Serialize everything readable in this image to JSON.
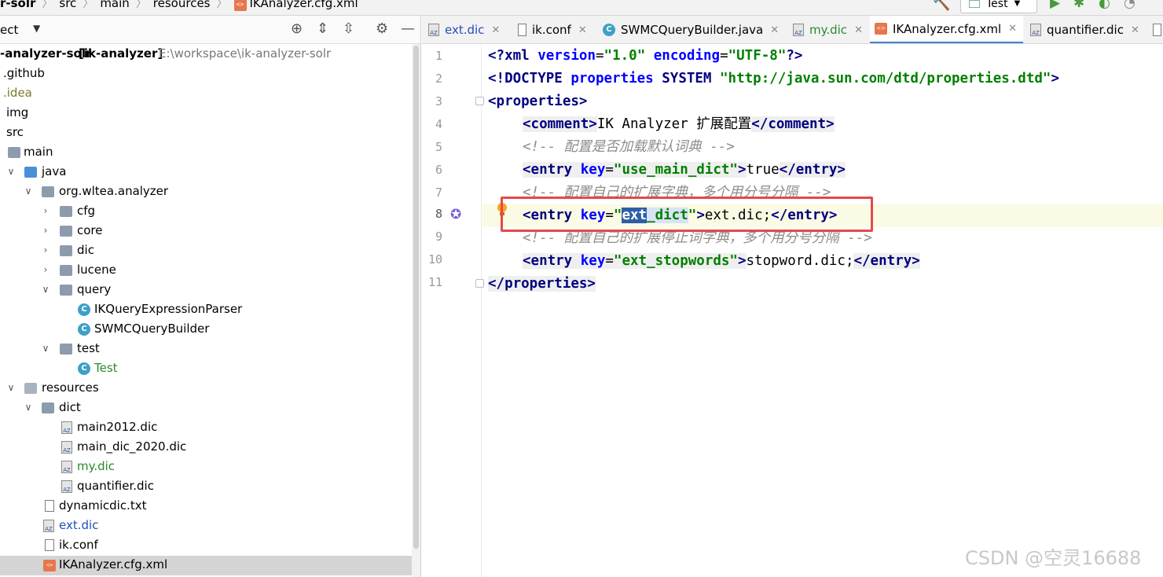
{
  "navbar": {
    "crumbs": [
      "r-solr",
      "src",
      "main",
      "resources",
      "IKAnalyzer.cfg.xml"
    ],
    "run_config": "Test"
  },
  "project": {
    "title": "ect",
    "root": {
      "name": "-analyzer-solr",
      "module": "[ik-analyzer]",
      "path": "E:\\workspace\\ik-analyzer-solr"
    },
    "tree": [
      {
        "label": ".github"
      },
      {
        "label": ".idea"
      },
      {
        "label": "img"
      },
      {
        "label": "src"
      },
      {
        "label": "main"
      },
      {
        "label": "java"
      },
      {
        "label": "org.wltea.analyzer"
      },
      {
        "label": "cfg"
      },
      {
        "label": "core"
      },
      {
        "label": "dic"
      },
      {
        "label": "lucene"
      },
      {
        "label": "query"
      },
      {
        "label": "IKQueryExpressionParser"
      },
      {
        "label": "SWMCQueryBuilder"
      },
      {
        "label": "test"
      },
      {
        "label": "Test"
      },
      {
        "label": "resources"
      },
      {
        "label": "dict"
      },
      {
        "label": "main2012.dic"
      },
      {
        "label": "main_dic_2020.dic"
      },
      {
        "label": "my.dic"
      },
      {
        "label": "quantifier.dic"
      },
      {
        "label": "dynamicdic.txt"
      },
      {
        "label": "ext.dic"
      },
      {
        "label": "ik.conf"
      },
      {
        "label": "IKAnalyzer.cfg.xml"
      }
    ]
  },
  "editor": {
    "tabs": [
      {
        "label": "ext.dic"
      },
      {
        "label": "ik.conf"
      },
      {
        "label": "SWMCQueryBuilder.java"
      },
      {
        "label": "my.dic"
      },
      {
        "label": "IKAnalyzer.cfg.xml"
      },
      {
        "label": "quantifier.dic"
      }
    ],
    "line_numbers": [
      "1",
      "2",
      "3",
      "4",
      "5",
      "6",
      "7",
      "8",
      "9",
      "10",
      "11"
    ],
    "code": {
      "l1": {
        "a": "<?",
        "b": "xml ",
        "c": "version",
        "d": "=",
        "e": "\"1.0\"",
        "f": " encoding",
        "g": "=",
        "h": "\"UTF-8\"",
        "i": "?>"
      },
      "l2": {
        "a": "<!DOCTYPE ",
        "b": "properties",
        "c": " SYSTEM ",
        "d": "\"http://java.sun.com/dtd/properties.dtd\"",
        "e": ">"
      },
      "l3": {
        "a": "<properties>"
      },
      "l4": {
        "a": "<comment>",
        "b": "IK Analyzer 扩展配置",
        "c": "</comment>"
      },
      "l5": {
        "a": "<!-- 配置是否加载默认词典 -->"
      },
      "l6": {
        "a": "<entry ",
        "b": "key",
        "c": "=",
        "d": "\"use_main_dict\"",
        "e": ">",
        "f": "true",
        "g": "</entry>"
      },
      "l7": {
        "a": "<!-- 配置自己的扩展字典，多个用分号分隔 -->"
      },
      "l8": {
        "a": "<entry ",
        "b": "key",
        "c": "=",
        "d": "\"",
        "e": "ext",
        "f": "_dict",
        "g": "\"",
        "h": ">",
        "i": "ext.dic;",
        "j": "</entry>"
      },
      "l9": {
        "a": "<!-- 配置自己的扩展停止词字典，多个用分号分隔 -->"
      },
      "l10": {
        "a": "<entry ",
        "b": "key",
        "c": "=",
        "d": "\"ext_stopwords\"",
        "e": ">",
        "f": "stopword.dic;",
        "g": "</entry>"
      },
      "l11": {
        "a": "</properties>"
      }
    }
  },
  "watermark": "CSDN @空灵16688",
  "colors": {
    "tag": "#000080",
    "attribute": "#0000ff",
    "string": "#008000",
    "comment": "#8c8c8c",
    "selection": "#2c5fa8",
    "annotation_box": "#e24a4a",
    "active_tab_underline": "#4083c9"
  }
}
